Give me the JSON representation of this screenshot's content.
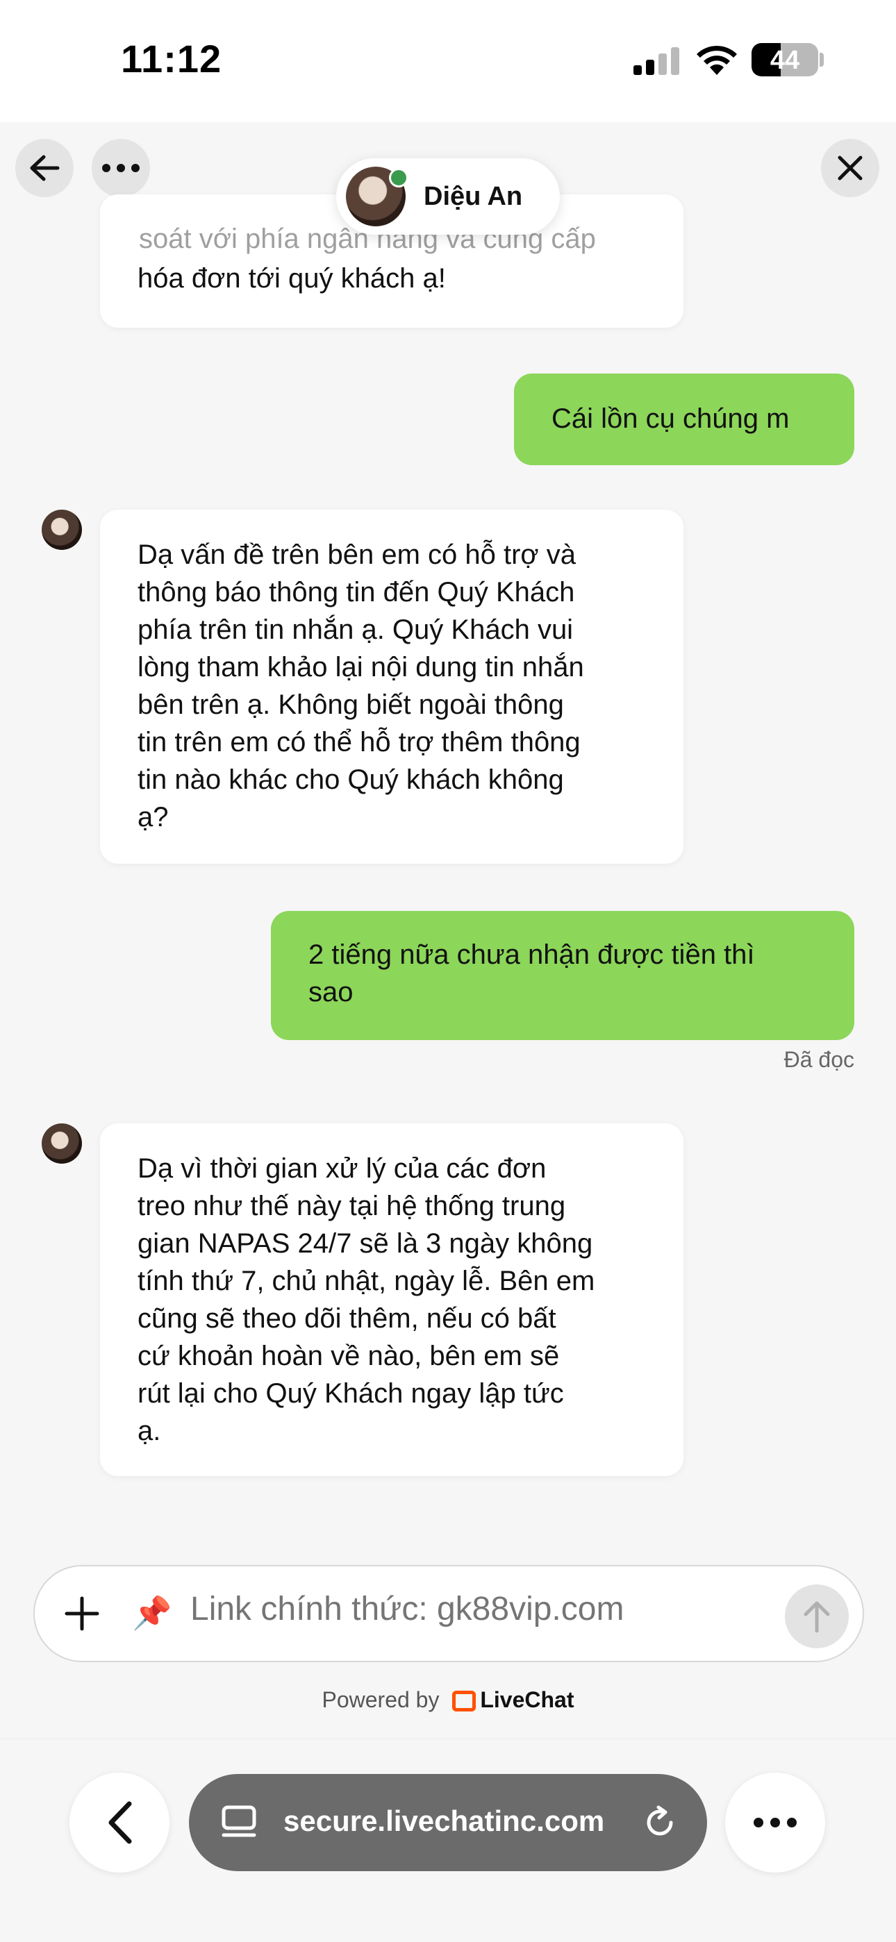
{
  "status_bar": {
    "time": "11:12",
    "battery": "44",
    "battery_level": 0.44
  },
  "header": {
    "agent_name": "Diệu An"
  },
  "messages": [
    {
      "from": "agent",
      "text": "hóa đơn tới quý khách ạ!",
      "faded": "soát với phía ngân hàng và cung cấp"
    },
    {
      "from": "user",
      "text": "Cái lồn cụ chúng m"
    },
    {
      "from": "agent",
      "text": "Dạ vấn đề trên bên em có hỗ trợ và\nthông báo thông tin đến Quý Khách\nphía trên tin nhắn ạ. Quý Khách vui\nlòng tham khảo lại nội dung tin nhắn\nbên trên ạ. Không biết ngoài thông\ntin trên em có thể hỗ trợ thêm thông\ntin nào khác cho Quý khách không\nạ?"
    },
    {
      "from": "user",
      "text": "2 tiếng nữa chưa nhận được tiền thì\nsao"
    },
    {
      "from": "agent",
      "text": "Dạ vì thời gian xử lý của các đơn\ntreo như thế này tại hệ thống trung\ngian NAPAS 24/7 sẽ là 3 ngày không\ntính thứ 7, chủ nhật, ngày lễ. Bên em\ncũng sẽ theo dõi thêm, nếu có bất\ncứ khoản hoàn về nào, bên em sẽ\nrút lại cho Quý Khách ngay lập tức\nạ."
    }
  ],
  "read_status": "Đã đọc",
  "composer": {
    "pin_emoji": "📌",
    "placeholder": "Link chính thức: gk88vip.com"
  },
  "footer": {
    "powered_by": "Powered by",
    "brand": "LiveChat"
  },
  "browser": {
    "url": "secure.livechatinc.com"
  },
  "colors": {
    "user_bubble": "#8cd65a",
    "online": "#3a9b4c",
    "livechat_brand": "#ff5100"
  }
}
